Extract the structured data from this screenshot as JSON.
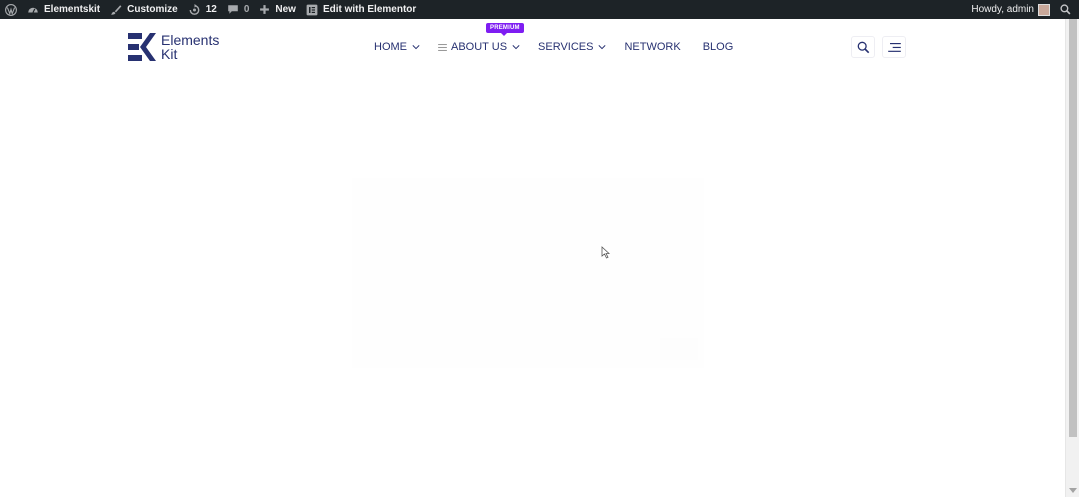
{
  "admin_bar": {
    "site_name": "Elementskit",
    "customize": "Customize",
    "updates_count": "12",
    "comments_count": "0",
    "new_label": "New",
    "edit_label": "Edit with Elementor",
    "greeting": "Howdy, admin"
  },
  "header": {
    "logo_line1": "Elements",
    "logo_line2": "Kit",
    "nav": [
      {
        "label": "HOME"
      },
      {
        "label": "ABOUT US",
        "badge": "PREMIUM"
      },
      {
        "label": "SERVICES"
      },
      {
        "label": "NETWORK"
      },
      {
        "label": "BLOG"
      }
    ]
  },
  "icons": {
    "wp_logo": "wordpress-icon",
    "dashboard": "dashboard-icon",
    "brush": "brush-icon",
    "updates": "updates-icon",
    "comment": "comment-icon",
    "plus": "plus-icon",
    "elementor": "elementor-icon",
    "search": "search-icon",
    "menu": "hamburger-icon"
  },
  "colors": {
    "admin_bar_bg": "#1d2327",
    "brand": "#273171",
    "badge": "#7e1df2"
  }
}
